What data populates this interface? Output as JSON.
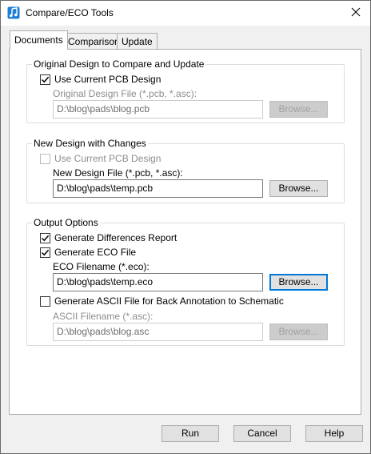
{
  "window": {
    "title": "Compare/ECO Tools"
  },
  "tabs": [
    {
      "label": "Documents"
    },
    {
      "label": "Comparison"
    },
    {
      "label": "Update"
    }
  ],
  "original": {
    "group_title": "Original Design to Compare and Update",
    "use_current_label": "Use Current PCB Design",
    "use_current_checked": true,
    "file_label": "Original Design File (*.pcb, *.asc):",
    "file_value": "D:\\blog\\pads\\blog.pcb",
    "browse_label": "Browse..."
  },
  "new_design": {
    "group_title": "New Design with Changes",
    "use_current_label": "Use Current PCB Design",
    "use_current_checked": false,
    "file_label": "New Design File (*.pcb, *.asc):",
    "file_value": "D:\\blog\\pads\\temp.pcb",
    "browse_label": "Browse..."
  },
  "output": {
    "group_title": "Output Options",
    "diff_report_label": "Generate Differences Report",
    "diff_report_checked": true,
    "eco_file_label": "Generate ECO File",
    "eco_file_checked": true,
    "eco_filename_label": "ECO Filename (*.eco):",
    "eco_filename_value": "D:\\blog\\pads\\temp.eco",
    "eco_browse_label": "Browse...",
    "ascii_label": "Generate ASCII File for Back Annotation to Schematic",
    "ascii_checked": false,
    "ascii_filename_label": "ASCII Filename (*.asc):",
    "ascii_filename_value": "D:\\blog\\pads\\blog.asc",
    "ascii_browse_label": "Browse..."
  },
  "buttons": {
    "run": "Run",
    "cancel": "Cancel",
    "help": "Help"
  },
  "colors": {
    "accent": "#0078d7",
    "window_bg": "#f0f0f0",
    "panel_bg": "#ffffff",
    "disabled_text": "#8d8d8d"
  },
  "icons": {
    "app": "music-note-icon",
    "close": "close-icon",
    "check": "check-icon"
  }
}
